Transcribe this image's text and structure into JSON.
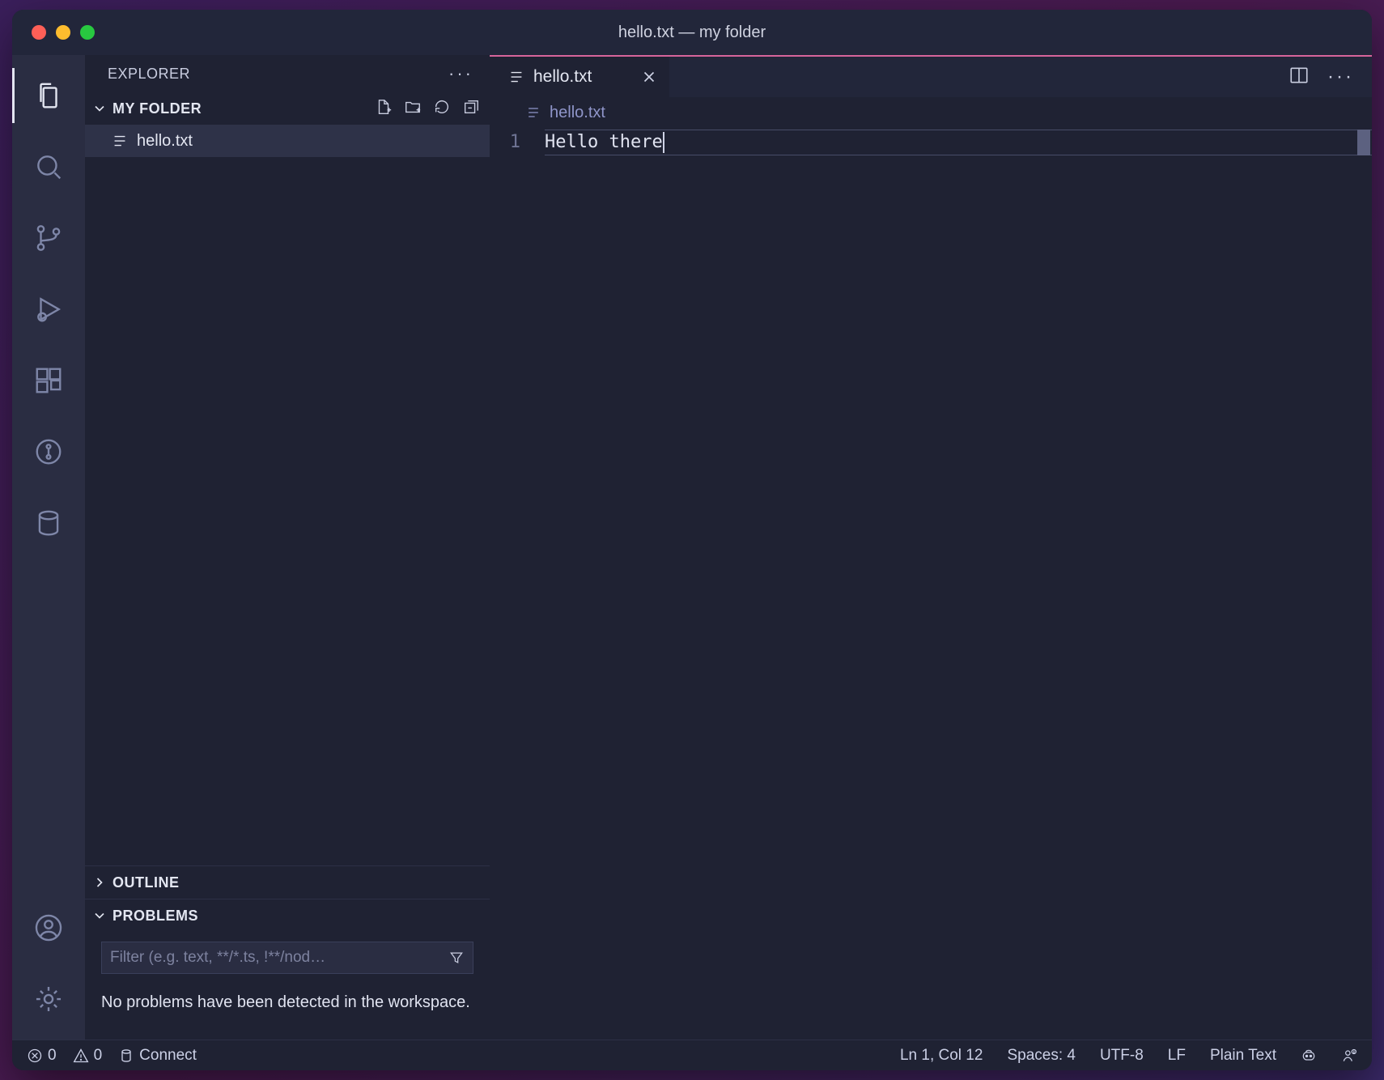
{
  "title": "hello.txt — my folder",
  "explorer": {
    "title": "EXPLORER",
    "folder_name": "MY FOLDER",
    "files": [
      {
        "name": "hello.txt"
      }
    ],
    "outline_label": "OUTLINE",
    "problems_label": "PROBLEMS",
    "problems_filter_placeholder": "Filter (e.g. text, **/*.ts, !**/nod…",
    "problems_message": "No problems have been detected in the workspace."
  },
  "tabs": [
    {
      "label": "hello.txt"
    }
  ],
  "breadcrumb": "hello.txt",
  "editor": {
    "lines": [
      {
        "number": "1",
        "text": "Hello there"
      }
    ]
  },
  "statusbar": {
    "errors": "0",
    "warnings": "0",
    "remote_label": "Connect",
    "position": "Ln 1, Col 12",
    "spaces": "Spaces: 4",
    "encoding": "UTF-8",
    "eol": "LF",
    "language": "Plain Text"
  }
}
